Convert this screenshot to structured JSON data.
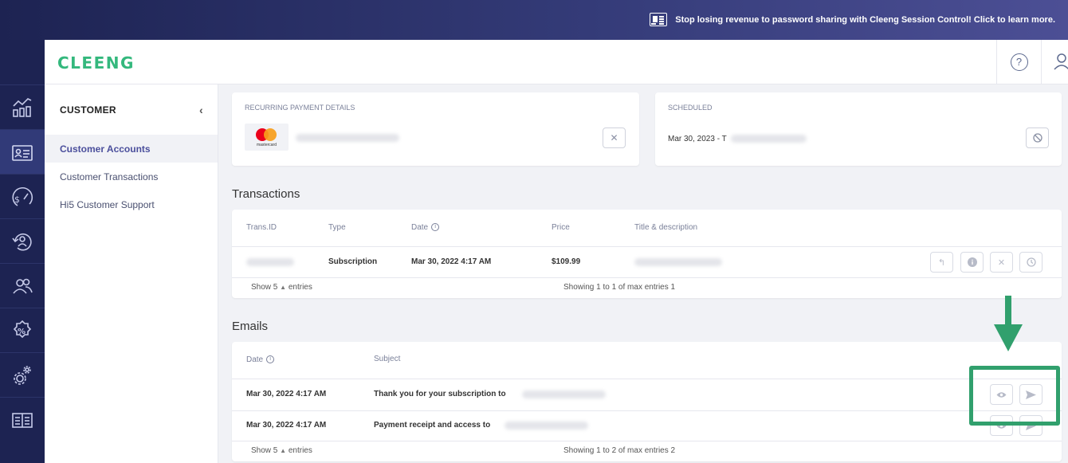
{
  "banner": {
    "message": "Stop losing revenue to password sharing with Cleeng Session Control! Click to learn more."
  },
  "header": {
    "logo": "CLEENG",
    "help": "?"
  },
  "subnav": {
    "title": "CUSTOMER",
    "items": [
      {
        "label": "Customer Accounts",
        "active": true
      },
      {
        "label": "Customer Transactions",
        "active": false
      },
      {
        "label": "Hi5 Customer Support",
        "active": false
      }
    ]
  },
  "payment": {
    "label": "RECURRING PAYMENT DETAILS",
    "card_brand": "mastercard"
  },
  "scheduled": {
    "label": "SCHEDULED",
    "date": "Mar 30, 2023 - T"
  },
  "transactions": {
    "title": "Transactions",
    "columns": [
      "Trans.ID",
      "Type",
      "Date",
      "Price",
      "Title & description"
    ],
    "rows": [
      {
        "type": "Subscription",
        "date": "Mar 30, 2022 4:17 AM",
        "price": "$109.99"
      }
    ],
    "footer_show": "Show 5",
    "footer_entries": "entries",
    "footer_info": "Showing 1 to 1 of max entries 1"
  },
  "emails": {
    "title": "Emails",
    "columns": [
      "Date",
      "Subject"
    ],
    "rows": [
      {
        "date": "Mar 30, 2022 4:17 AM",
        "subject": "Thank you for your subscription to"
      },
      {
        "date": "Mar 30, 2022 4:17 AM",
        "subject": "Payment receipt and access to"
      }
    ],
    "footer_show": "Show 5",
    "footer_entries": "entries",
    "footer_info": "Showing 1 to 2 of max entries 2"
  },
  "colors": {
    "rail": "#1d2352",
    "accent": "#4b4f9c",
    "logo_green": "#34b87d",
    "annotation_green": "#31a06d"
  }
}
